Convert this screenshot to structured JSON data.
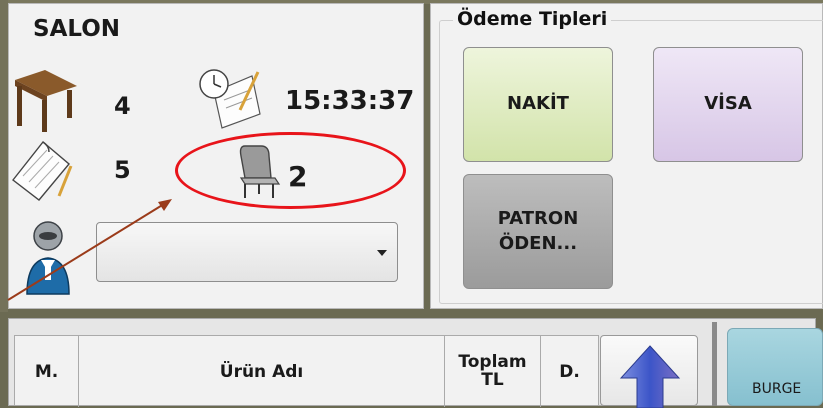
{
  "salon": {
    "label": "SALON",
    "table_no": "4",
    "order_no": "5",
    "time": "15:33:37",
    "guest_count": "2",
    "waiter_select_value": ""
  },
  "payment": {
    "group_title": "Ödeme Tipleri",
    "buttons": [
      "NAKİT",
      "VİSA",
      "PATRON\nÖDEN..."
    ]
  },
  "grid": {
    "columns": [
      "M.",
      "Ürün Adı",
      "Toplam TL",
      "D."
    ]
  },
  "category_button": "BURGE",
  "colors": {
    "highlight": "#e8141a",
    "arrow": "#9b3b1a",
    "nakit": "#d2e3aa",
    "visa": "#d7c6e6",
    "patron": "#9b9b9b",
    "category": "#86c0cf"
  },
  "icons": [
    "table-icon",
    "clock-icon",
    "notepad-icon",
    "chair-icon",
    "waiter-icon",
    "arrow-up-icon"
  ]
}
